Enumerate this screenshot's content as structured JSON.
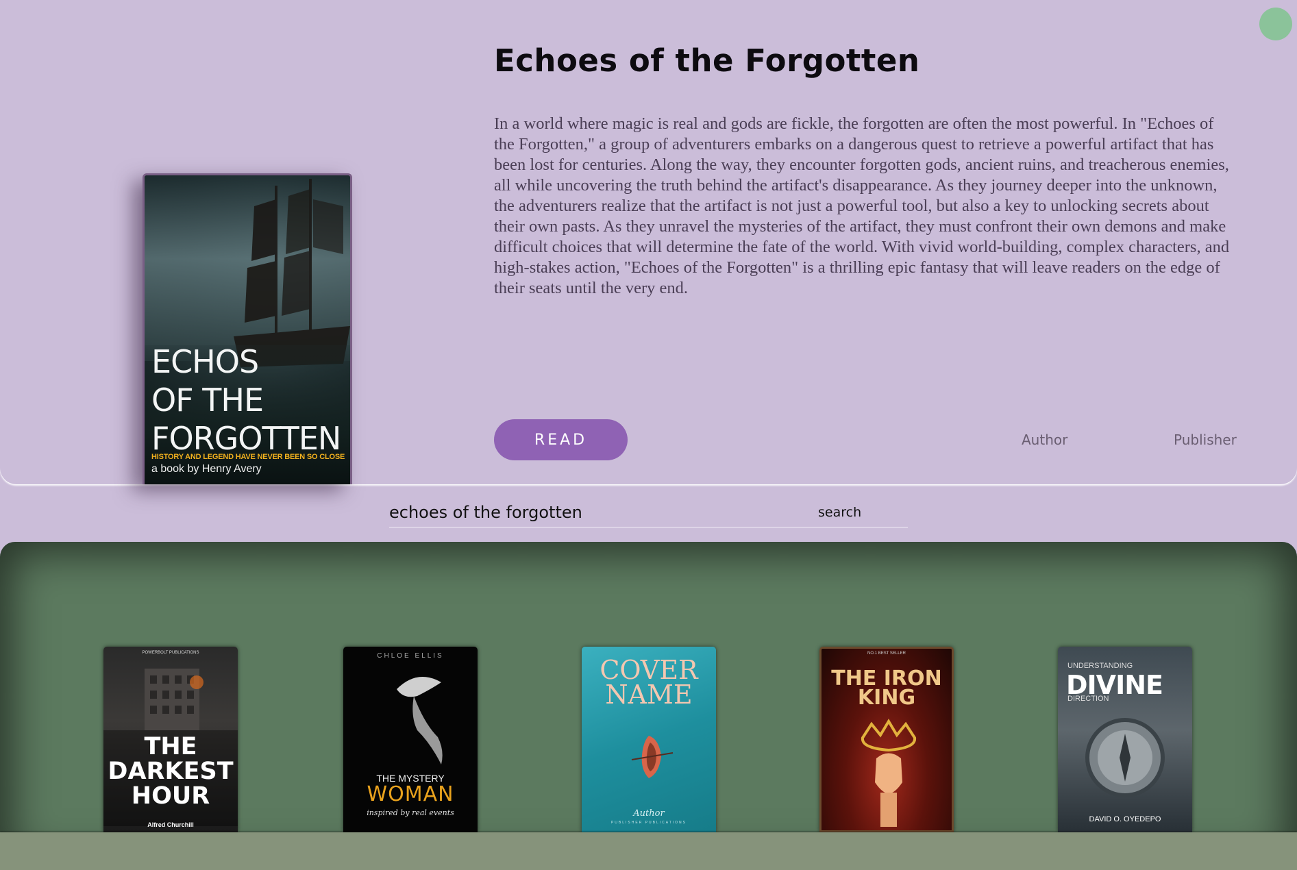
{
  "featured": {
    "title": "Echoes of the Forgotten",
    "description": "In a world where magic is real and gods are fickle, the forgotten are often the most powerful. In \"Echoes of the Forgotten,\" a group of adventurers embarks on a dangerous quest to retrieve a powerful artifact that has been lost for centuries. Along the way, they encounter forgotten gods, ancient ruins, and treacherous enemies, all while uncovering the truth behind the artifact's disappearance. As they journey deeper into the unknown, the adventurers realize that the artifact is not just a powerful tool, but also a key to unlocking secrets about their own pasts. As they unravel the mysteries of the artifact, they must confront their own demons and make difficult choices that will determine the fate of the world. With vivid world-building, complex characters, and high-stakes action, \"Echoes of the Forgotten\" is a thrilling epic fantasy that will leave readers on the edge of their seats until the very end.",
    "read_label": "READ",
    "author_label": "Author",
    "publisher_label": "Publisher",
    "cover": {
      "title": "ECHOS\nOF THE\nFORGOTTEN",
      "tagline": "HISTORY AND LEGEND HAVE NEVER BEEN SO CLOSE",
      "byline": "a book by Henry Avery"
    }
  },
  "search": {
    "value": "echoes of the forgotten",
    "button_label": "search"
  },
  "shelf": {
    "books": [
      {
        "publisher": "POWERBOLT PUBLICATIONS",
        "title": "THE\nDARKEST\nHOUR",
        "author": "Alfred Churchill"
      },
      {
        "publisher": "CHLOE ELLIS",
        "subtitle": "THE MYSTERY",
        "title": "WOMAN",
        "note": "inspired by real events"
      },
      {
        "title": "COVER\nNAME",
        "author": "Author",
        "publisher": "PUBLISHER PUBLICATIONS"
      },
      {
        "publisher": "NO.1 BEST SELLER",
        "title": "THE IRON\nKING"
      },
      {
        "pre": "UNDERSTANDING",
        "title": "DIVINE",
        "post": "DIRECTION",
        "author": "DAVID O. OYEDEPO"
      }
    ]
  },
  "colors": {
    "hero_bg": "#cbbdd9",
    "accent": "#8f62b4",
    "shelf_bg": "#5c7a5f",
    "footer_bg": "#86937b",
    "status_dot": "#8bc39a"
  }
}
